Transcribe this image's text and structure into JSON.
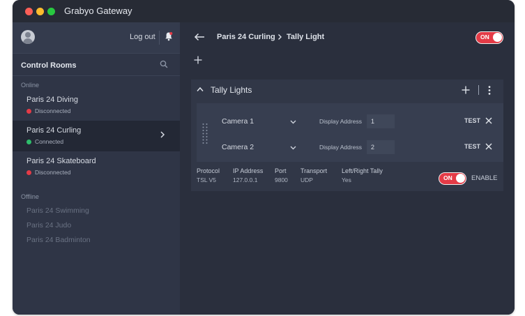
{
  "window": {
    "title": "Grabyo Gateway"
  },
  "sidebar": {
    "logout_label": "Log out",
    "section_title": "Control Rooms",
    "online_label": "Online",
    "offline_label": "Offline",
    "online_rooms": [
      {
        "name": "Paris 24 Diving",
        "status": "Disconnected",
        "status_color": "#e43b47"
      },
      {
        "name": "Paris 24 Curling",
        "status": "Connected",
        "status_color": "#2ebd6b"
      },
      {
        "name": "Paris 24 Skateboard",
        "status": "Disconnected",
        "status_color": "#e43b47"
      }
    ],
    "offline_rooms": [
      "Paris 24 Swimming",
      "Paris 24 Judo",
      "Paris 24 Badminton"
    ]
  },
  "header": {
    "breadcrumb_room": "Paris 24 Curling",
    "breadcrumb_page": "Tally Light",
    "toggle_label": "ON"
  },
  "panel": {
    "title": "Tally Lights",
    "cameras": [
      {
        "name": "Camera 1",
        "address_label": "Display Address",
        "address": "1",
        "test_label": "TEST"
      },
      {
        "name": "Camera 2",
        "address_label": "Display Address",
        "address": "2",
        "test_label": "TEST"
      }
    ],
    "properties": [
      {
        "key": "Protocol",
        "value": "TSL V5"
      },
      {
        "key": "IP Address",
        "value": "127.0.0.1"
      },
      {
        "key": "Port",
        "value": "9800"
      },
      {
        "key": "Transport",
        "value": "UDP"
      },
      {
        "key": "Left/Right Tally",
        "value": "Yes"
      }
    ],
    "toggle_label": "ON",
    "enable_label": "ENABLE"
  },
  "colors": {
    "accent_red": "#e43b47",
    "connected_green": "#2ebd6b"
  }
}
